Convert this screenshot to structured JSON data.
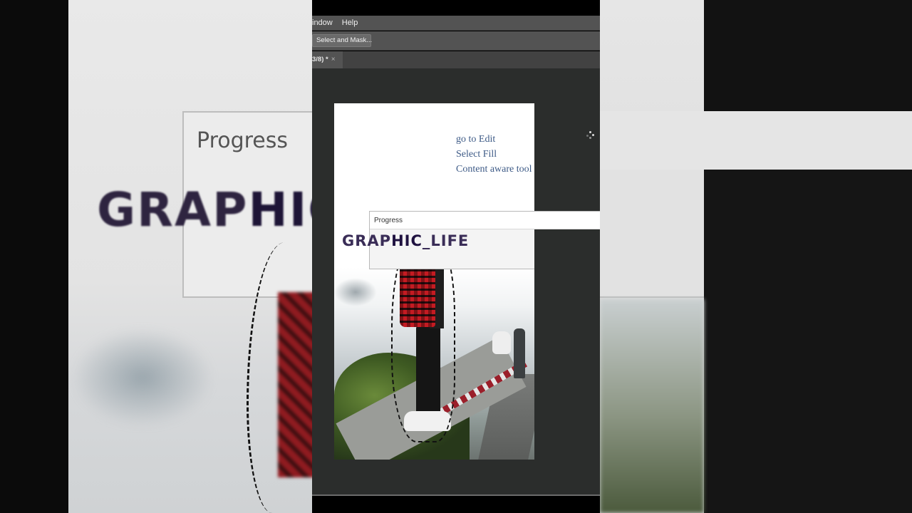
{
  "menu": {
    "items": [
      "indow",
      "Help"
    ]
  },
  "options": {
    "select_and_mask": "Select and Mask..."
  },
  "document_tab": {
    "title": "3/8) *",
    "close": "×"
  },
  "notes": {
    "line1": "go to Edit",
    "line2": "Select Fill",
    "line3": "Content aware tool"
  },
  "progress_dialog": {
    "title": "Progress"
  },
  "watermark": {
    "part1": "GRAP",
    "part2": "HIC",
    "part3": "_LIFE"
  },
  "backdrop": {
    "progress_title": "Progress",
    "big_text_a": "GRAP",
    "big_text_b": "HIC"
  },
  "icons": {
    "spinner": "loading-spinner-icon",
    "close": "close-icon"
  },
  "colors": {
    "note_text": "#3d5a86",
    "watermark": "#3a2d57",
    "ui_panel": "#535353",
    "workspace": "#2b2d2c"
  }
}
